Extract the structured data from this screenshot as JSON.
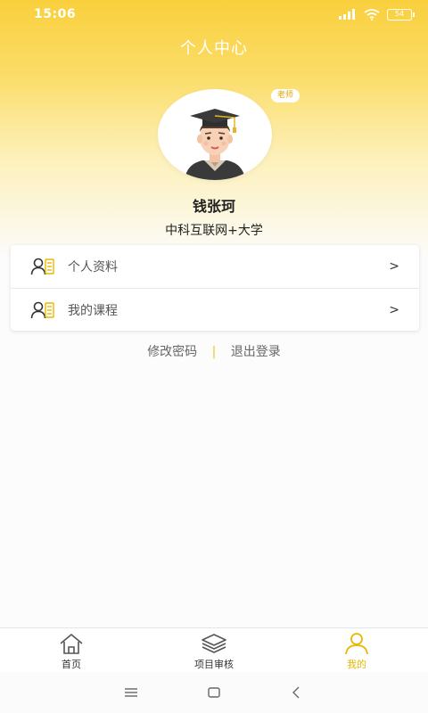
{
  "status_bar": {
    "time": "15:06",
    "battery": "54",
    "icons": [
      "hd-signal-icon",
      "wifi-icon",
      "battery-icon"
    ]
  },
  "header": {
    "title": "个人中心"
  },
  "profile": {
    "role_badge": "老师",
    "name": "钱张珂",
    "organization": "中科互联网+大学",
    "avatar_icon": "graduate-avatar-icon"
  },
  "menu": [
    {
      "label": "个人资料",
      "icon": "user-card-icon",
      "chevron": ">"
    },
    {
      "label": "我的课程",
      "icon": "user-card-icon",
      "chevron": ">"
    }
  ],
  "links": {
    "change_password": "修改密码",
    "separator": "|",
    "logout": "退出登录"
  },
  "tabs": [
    {
      "label": "首页",
      "icon": "home-icon",
      "active": false
    },
    {
      "label": "项目审核",
      "icon": "layers-icon",
      "active": false
    },
    {
      "label": "我的",
      "icon": "person-icon",
      "active": true
    }
  ],
  "system_nav": [
    "menu-icon",
    "home-square-icon",
    "back-icon"
  ],
  "colors": {
    "accent": "#f9cf3c",
    "active_tab": "#e8b800",
    "badge_text": "#e2a400"
  }
}
